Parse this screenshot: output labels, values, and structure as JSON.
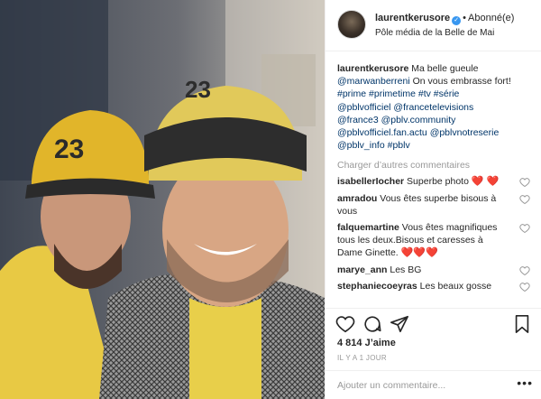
{
  "post": {
    "username": "laurentkerusore",
    "verified_mark": "✓",
    "separator": "•",
    "follow_state": "Abonné(e)",
    "location": "Pôle média de la Belle de Mai"
  },
  "caption": {
    "author": "laurentkerusore",
    "text1": "Ma belle gueule",
    "mention": "@marwanberreni",
    "text2": "On vous embrasse fort!",
    "tags_line1": "#prime #primetime #tv #série",
    "tags_line2": "@pblvofficiel @francetelevisions",
    "tags_line3": "@france3 @pblv.community",
    "tags_line4": "@pblvofficiel.fan.actu @pblvnotreserie",
    "tags_line5": "@pblv_info #pblv"
  },
  "load_more": "Charger d’autres commentaires",
  "comments": [
    {
      "user": "isabellerIocher",
      "text": "Superbe photo",
      "emoji": "❤️ ❤️"
    },
    {
      "user": "amradou",
      "text": "Vous êtes superbe bisous à vous",
      "emoji": ""
    },
    {
      "user": "falquemartine",
      "text": "Vous êtes magnifiques tous les deux.Bisous et caresses à Dame Ginette.",
      "emoji": "❤️❤️❤️"
    },
    {
      "user": "marye_ann",
      "text": "Les BG",
      "emoji": ""
    },
    {
      "user": "stephaniecoeyras",
      "text": "Les beaux gosse",
      "emoji": ""
    }
  ],
  "likes": "4 814 J’aime",
  "time": "IL Y A 1 JOUR",
  "add_comment": {
    "placeholder": "Ajouter un commentaire..."
  },
  "more": "•••",
  "photo": {
    "cap_number": "23"
  },
  "icons": {
    "like": "heart-outline-icon",
    "comment": "speech-bubble-icon",
    "share": "paper-plane-icon",
    "save": "bookmark-icon"
  },
  "colors": {
    "link": "#003569",
    "verified": "#3897f0",
    "muted": "#999999",
    "cap_yellow": "#e1b52a"
  }
}
